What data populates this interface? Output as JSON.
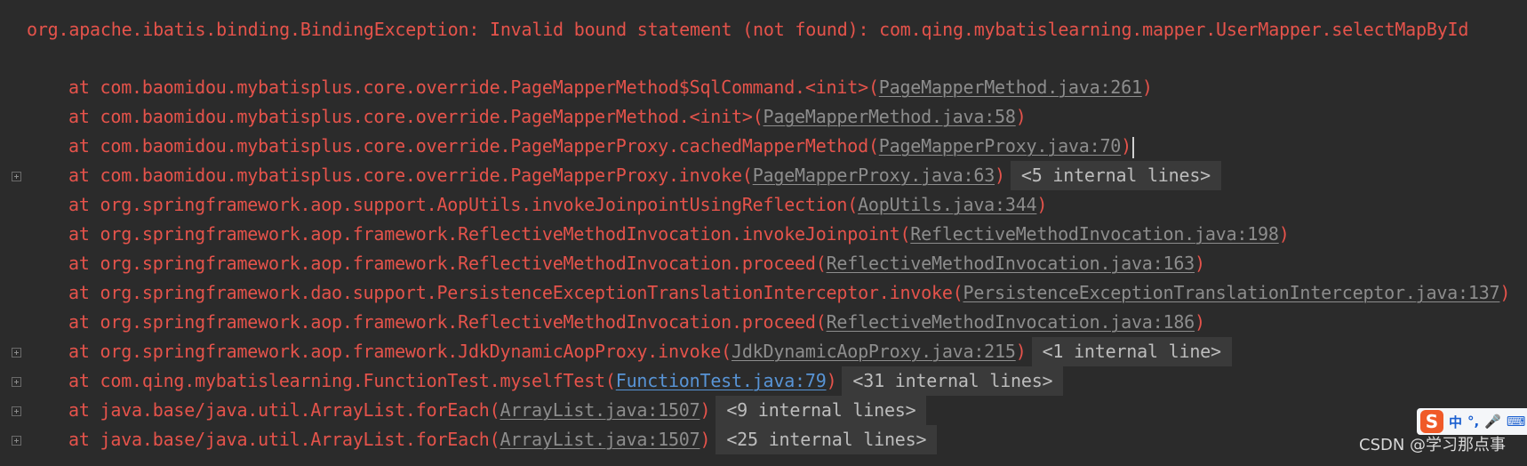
{
  "exception": {
    "text": "org.apache.ibatis.binding.BindingException: Invalid bound statement (not found): com.qing.mybatislearning.mapper.UserMapper.selectMapById"
  },
  "stack_frames": [
    {
      "at": "at ",
      "method": "com.baomidou.mybatisplus.core.override.PageMapperMethod$SqlCommand.<init>",
      "link": "PageMapperMethod.java:261",
      "fold": ""
    },
    {
      "at": "at ",
      "method": "com.baomidou.mybatisplus.core.override.PageMapperMethod.<init>",
      "link": "PageMapperMethod.java:58",
      "fold": ""
    },
    {
      "at": "at ",
      "method": "com.baomidou.mybatisplus.core.override.PageMapperProxy.cachedMapperMethod",
      "link": "PageMapperProxy.java:70",
      "fold": ""
    },
    {
      "at": "at ",
      "method": "com.baomidou.mybatisplus.core.override.PageMapperProxy.invoke",
      "link": "PageMapperProxy.java:63",
      "fold": "<5 internal lines>"
    },
    {
      "at": "at ",
      "method": "org.springframework.aop.support.AopUtils.invokeJoinpointUsingReflection",
      "link": "AopUtils.java:344",
      "fold": ""
    },
    {
      "at": "at ",
      "method": "org.springframework.aop.framework.ReflectiveMethodInvocation.invokeJoinpoint",
      "link": "ReflectiveMethodInvocation.java:198",
      "fold": ""
    },
    {
      "at": "at ",
      "method": "org.springframework.aop.framework.ReflectiveMethodInvocation.proceed",
      "link": "ReflectiveMethodInvocation.java:163",
      "fold": ""
    },
    {
      "at": "at ",
      "method": "org.springframework.dao.support.PersistenceExceptionTranslationInterceptor.invoke",
      "link": "PersistenceExceptionTranslationInterceptor.java:137",
      "fold": ""
    },
    {
      "at": "at ",
      "method": "org.springframework.aop.framework.ReflectiveMethodInvocation.proceed",
      "link": "ReflectiveMethodInvocation.java:186",
      "fold": ""
    },
    {
      "at": "at ",
      "method": "org.springframework.aop.framework.JdkDynamicAopProxy.invoke",
      "link": "JdkDynamicAopProxy.java:215",
      "fold": "<1 internal line>"
    },
    {
      "at": "at ",
      "method": "com.qing.mybatislearning.FunctionTest.myselfTest",
      "link": "FunctionTest.java:79",
      "fold": "<31 internal lines>"
    },
    {
      "at": "at ",
      "method": "java.base/java.util.ArrayList.forEach",
      "link": "ArrayList.java:1507",
      "fold": "<9 internal lines>"
    },
    {
      "at": "at ",
      "method": "java.base/java.util.ArrayList.forEach",
      "link": "ArrayList.java:1507",
      "fold": "<25 internal lines>"
    }
  ],
  "ime_toolbar": {
    "logo": "S",
    "items": [
      "中",
      "°,",
      "🎤",
      "⌨"
    ]
  },
  "watermark": {
    "text": "CSDN @学习那点事"
  },
  "colors": {
    "background": "#2b2b2b",
    "error_text": "#e5534b",
    "link_text": "#8d8d8d",
    "active_link": "#5894d6",
    "fold_background": "#3a3a3a"
  }
}
